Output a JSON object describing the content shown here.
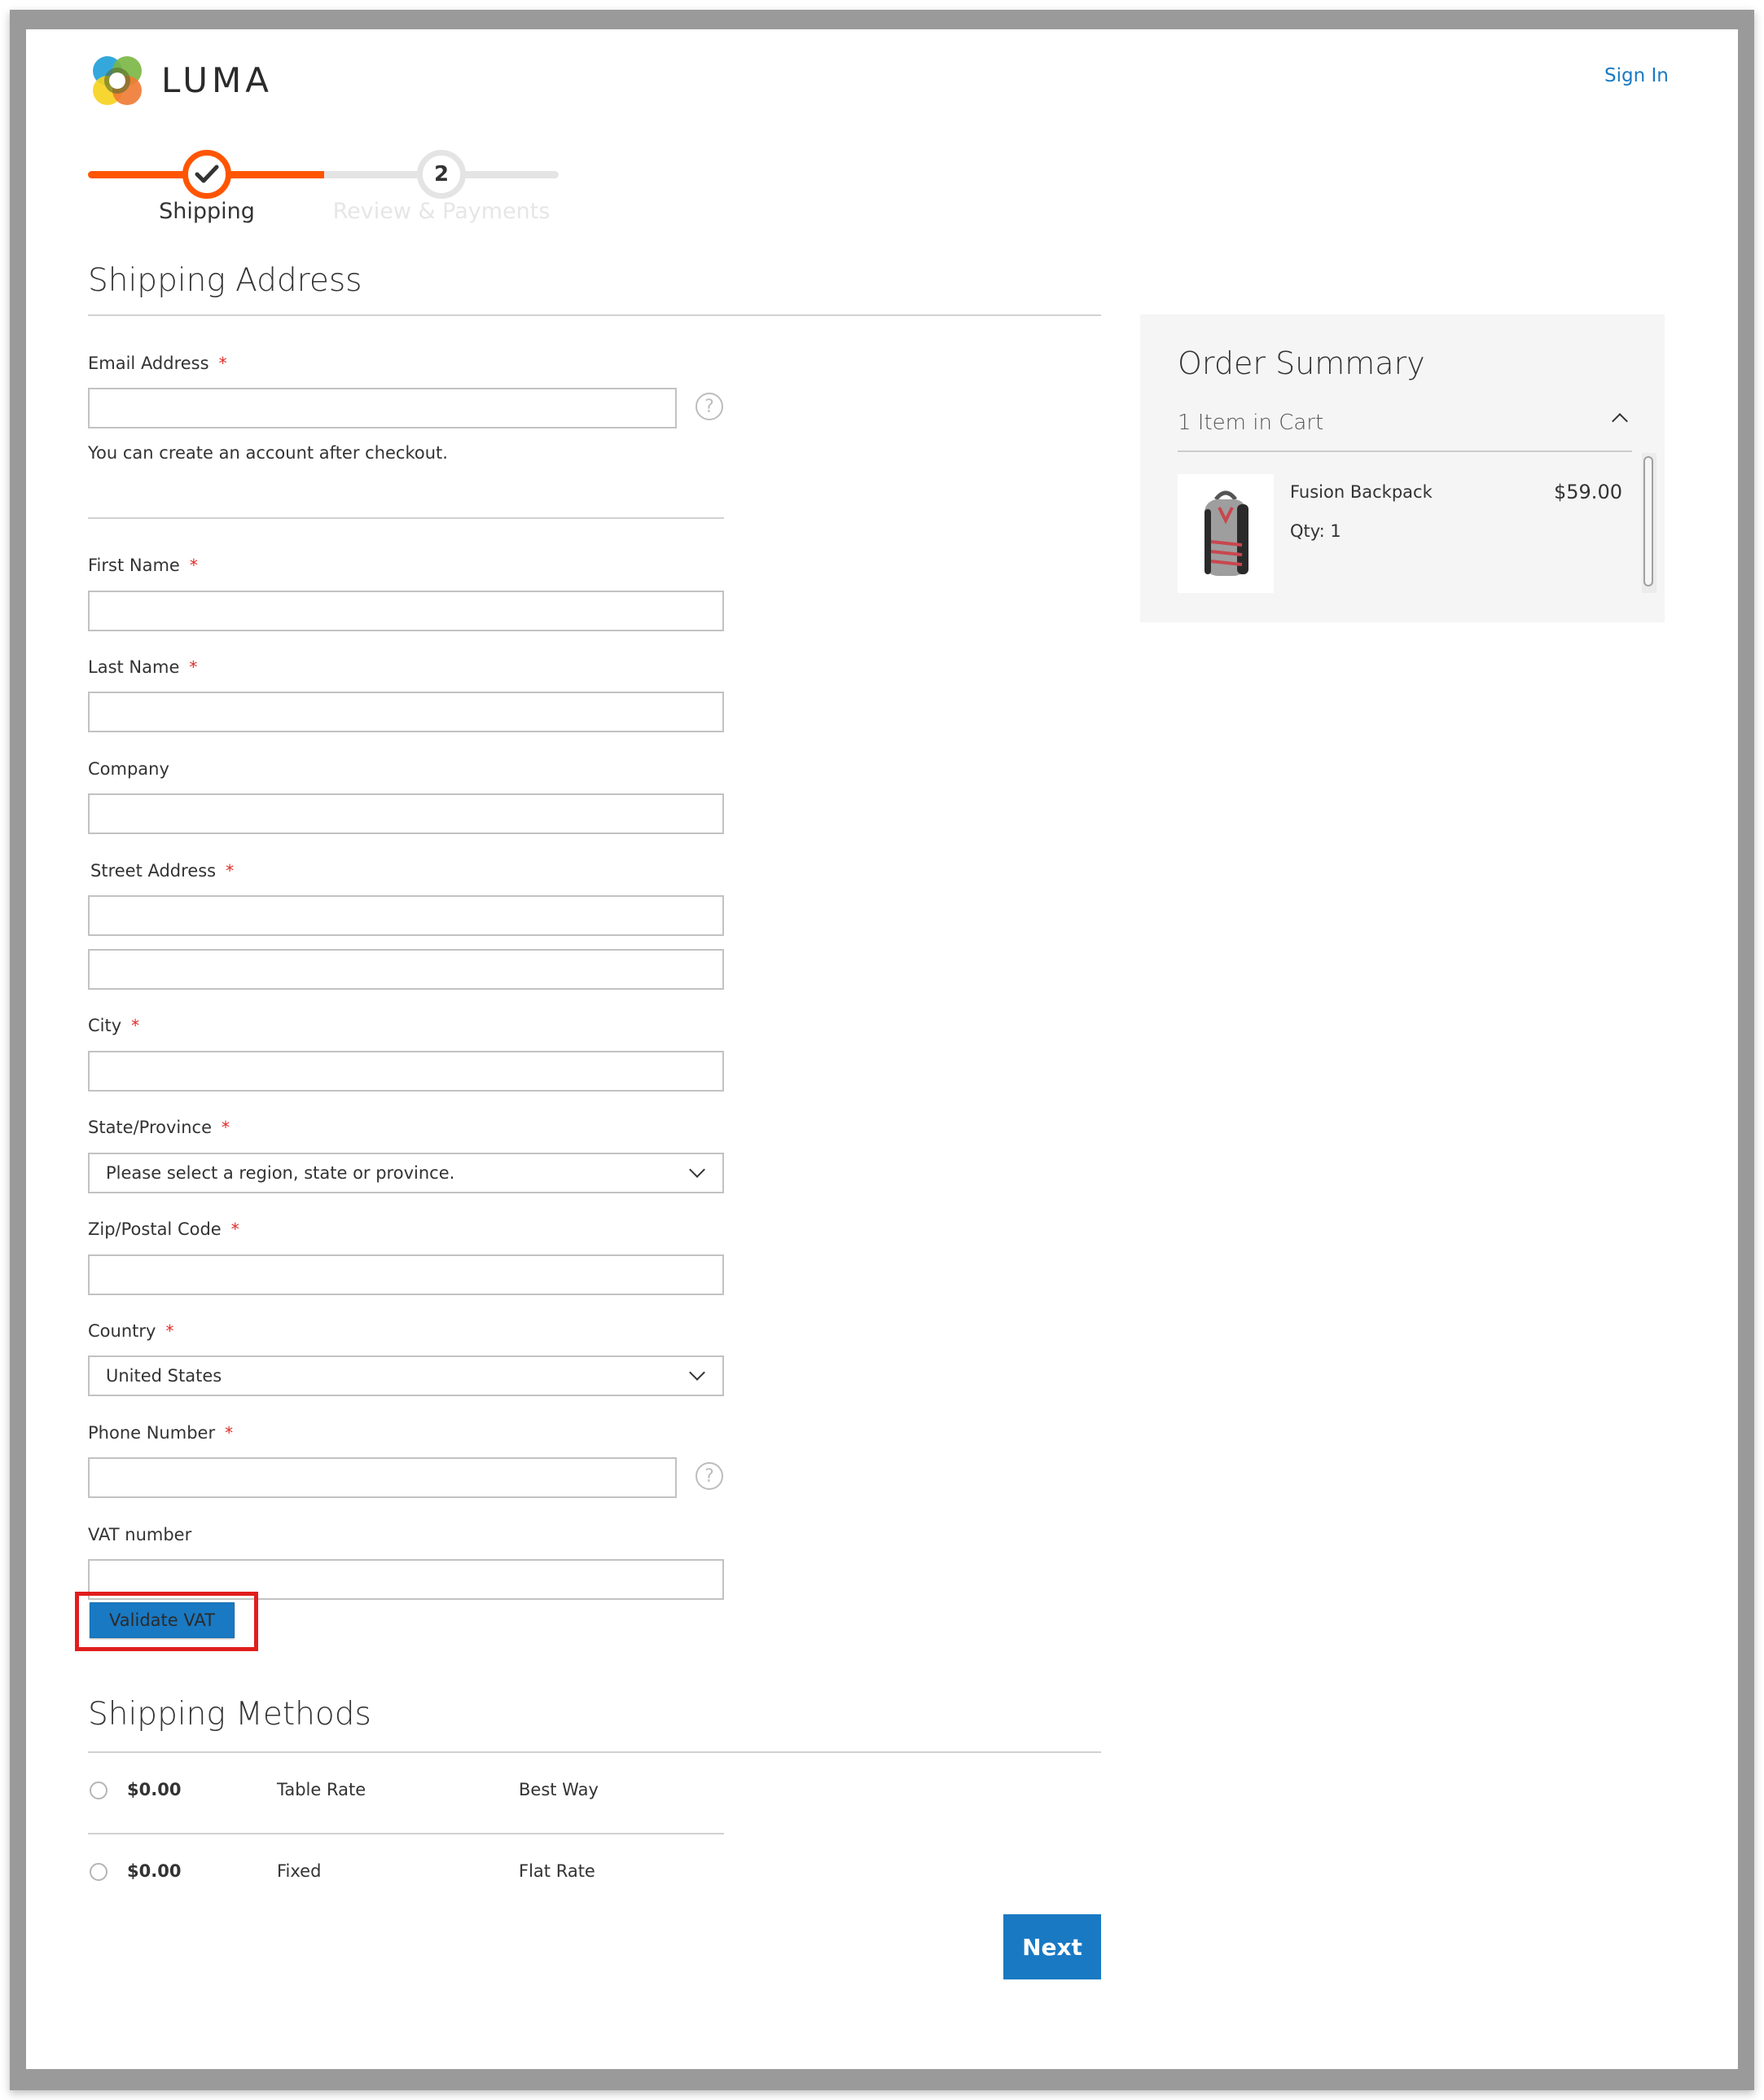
{
  "header": {
    "logo_text": "LUMA",
    "sign_in": "Sign In"
  },
  "progress": {
    "steps": [
      {
        "number": "1",
        "label": "Shipping",
        "status": "completed",
        "icon": "checkmark-icon"
      },
      {
        "number": "2",
        "label": "Review & Payments",
        "status": "pending"
      }
    ],
    "accent_color": "#ff5501"
  },
  "shipping_address": {
    "title": "Shipping Address",
    "email": {
      "label": "Email Address",
      "required": "*",
      "value": "",
      "help_icon": "?",
      "note": "You can create an account after checkout."
    },
    "first_name": {
      "label": "First Name",
      "required": "*",
      "value": ""
    },
    "last_name": {
      "label": "Last Name",
      "required": "*",
      "value": ""
    },
    "company": {
      "label": "Company",
      "value": ""
    },
    "street": {
      "label": "Street Address",
      "required": "*",
      "line1": "",
      "line2": ""
    },
    "city": {
      "label": "City",
      "required": "*",
      "value": ""
    },
    "state": {
      "label": "State/Province",
      "required": "*",
      "selected": "Please select a region, state or province."
    },
    "zip": {
      "label": "Zip/Postal Code",
      "required": "*",
      "value": ""
    },
    "country": {
      "label": "Country",
      "required": "*",
      "selected": "United States"
    },
    "phone": {
      "label": "Phone Number",
      "required": "*",
      "value": "",
      "help_icon": "?"
    },
    "vat": {
      "label": "VAT number",
      "value": "",
      "validate_button": "Validate VAT"
    }
  },
  "shipping_methods": {
    "title": "Shipping Methods",
    "options": [
      {
        "price": "$0.00",
        "method": "Table Rate",
        "carrier": "Best Way",
        "selected": false
      },
      {
        "price": "$0.00",
        "method": "Fixed",
        "carrier": "Flat Rate",
        "selected": false
      }
    ],
    "next_button": "Next"
  },
  "order_summary": {
    "title": "Order Summary",
    "items_count": "1 Item in Cart",
    "items": [
      {
        "name": "Fusion Backpack",
        "qty": "Qty: 1",
        "price": "$59.00"
      }
    ]
  },
  "colors": {
    "primary_blue": "#1979c3",
    "required_red": "#e02b27",
    "highlight_red": "#e11d1d"
  }
}
